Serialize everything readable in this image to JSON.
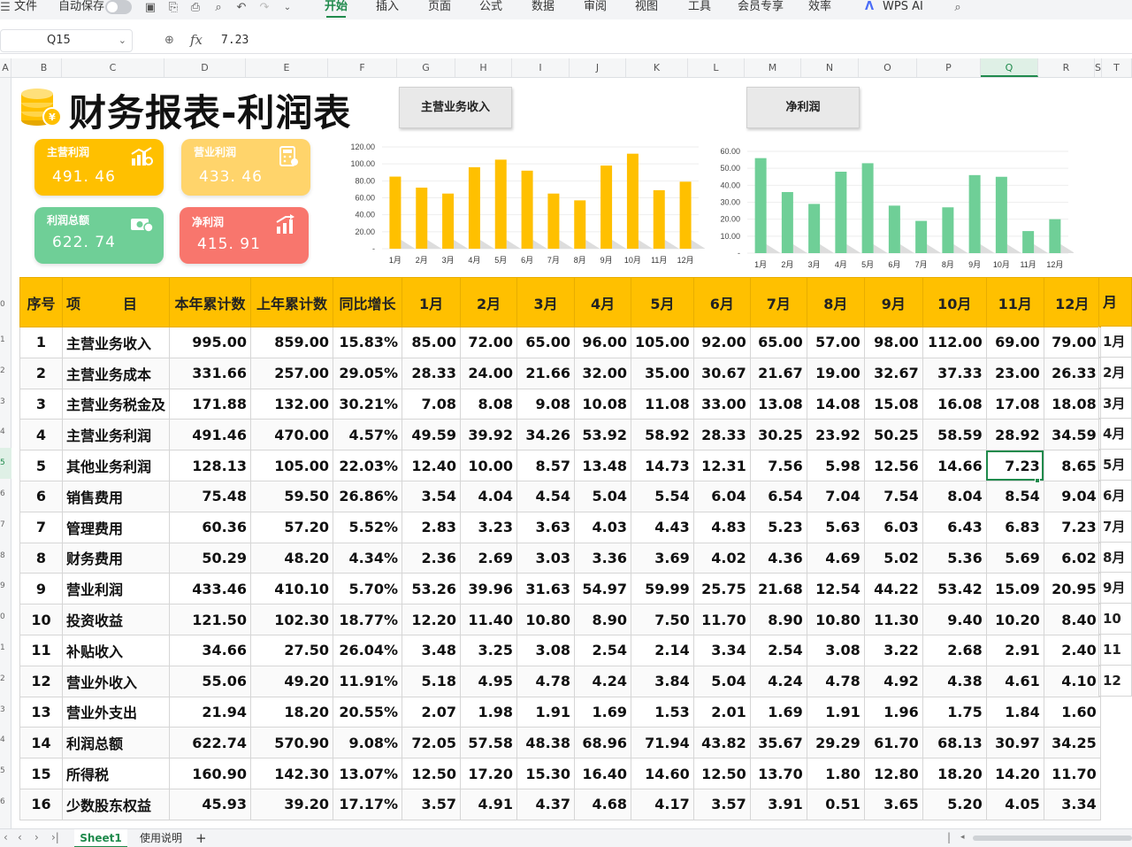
{
  "menu": {
    "file": "文件",
    "autosave": "自动保存",
    "tabs": [
      "开始",
      "插入",
      "页面",
      "公式",
      "数据",
      "审阅",
      "视图",
      "工具",
      "会员专享",
      "效率"
    ],
    "active_tab": "开始",
    "wps_ai": "WPS AI"
  },
  "formula": {
    "cell_ref": "Q15",
    "value": "7.23"
  },
  "columns": [
    "A",
    "B",
    "C",
    "D",
    "E",
    "F",
    "G",
    "H",
    "I",
    "J",
    "K",
    "L",
    "M",
    "N",
    "O",
    "P",
    "Q",
    "R",
    "S",
    "T"
  ],
  "selected_column": "Q",
  "row_numbers": [
    "0",
    "1",
    "2",
    "3",
    "4",
    "5",
    "6",
    "7",
    "8",
    "9",
    "0",
    "1",
    "2",
    "3",
    "4",
    "5",
    "6"
  ],
  "title": "财务报表-利润表",
  "buttons": {
    "revenue": "主营业务收入",
    "net_profit": "净利润"
  },
  "cards": [
    {
      "label": "主营利润",
      "value": "491. 46",
      "color": "#ffc000"
    },
    {
      "label": "营业利润",
      "value": "433. 46",
      "color": "#ffd46b"
    },
    {
      "label": "利润总额",
      "value": "622. 74",
      "color": "#6fcf97"
    },
    {
      "label": "净利润",
      "value": "415. 91",
      "color": "#f8766d"
    }
  ],
  "chart_data": [
    {
      "type": "bar",
      "categories": [
        "1月",
        "2月",
        "3月",
        "4月",
        "5月",
        "6月",
        "7月",
        "8月",
        "9月",
        "10月",
        "11月",
        "12月"
      ],
      "values": [
        85,
        72,
        65,
        96,
        105,
        92,
        65,
        57,
        98,
        112,
        69,
        79
      ],
      "ylim": [
        0,
        120
      ],
      "yticks": [
        "120.00",
        "100.00",
        "80.00",
        "60.00",
        "40.00",
        "20.00",
        "-"
      ],
      "color": "#ffc000"
    },
    {
      "type": "bar",
      "categories": [
        "1月",
        "2月",
        "3月",
        "4月",
        "5月",
        "6月",
        "7月",
        "8月",
        "9月",
        "10月",
        "11月",
        "12月"
      ],
      "values": [
        56,
        36,
        29,
        48,
        53,
        28,
        19,
        27,
        46,
        45,
        13,
        20
      ],
      "ylim": [
        0,
        60
      ],
      "yticks": [
        "60.00",
        "50.00",
        "40.00",
        "30.00",
        "20.00",
        "10.00",
        "-"
      ],
      "color": "#6fcf97"
    }
  ],
  "table": {
    "headers": [
      "序号",
      "项　　　目",
      "本年累计数",
      "上年累计数",
      "同比增长",
      "1月",
      "2月",
      "3月",
      "4月",
      "5月",
      "6月",
      "7月",
      "8月",
      "9月",
      "10月",
      "11月",
      "12月"
    ],
    "rows": [
      [
        "1",
        "主营业务收入",
        "995.00",
        "859.00",
        "15.83%",
        "85.00",
        "72.00",
        "65.00",
        "96.00",
        "105.00",
        "92.00",
        "65.00",
        "57.00",
        "98.00",
        "112.00",
        "69.00",
        "79.00"
      ],
      [
        "2",
        "主营业务成本",
        "331.66",
        "257.00",
        "29.05%",
        "28.33",
        "24.00",
        "21.66",
        "32.00",
        "35.00",
        "30.67",
        "21.67",
        "19.00",
        "32.67",
        "37.33",
        "23.00",
        "26.33"
      ],
      [
        "3",
        "主营业务税金及",
        "171.88",
        "132.00",
        "30.21%",
        "7.08",
        "8.08",
        "9.08",
        "10.08",
        "11.08",
        "33.00",
        "13.08",
        "14.08",
        "15.08",
        "16.08",
        "17.08",
        "18.08"
      ],
      [
        "4",
        "主营业务利润",
        "491.46",
        "470.00",
        "4.57%",
        "49.59",
        "39.92",
        "34.26",
        "53.92",
        "58.92",
        "28.33",
        "30.25",
        "23.92",
        "50.25",
        "58.59",
        "28.92",
        "34.59"
      ],
      [
        "5",
        "其他业务利润",
        "128.13",
        "105.00",
        "22.03%",
        "12.40",
        "10.00",
        "8.57",
        "13.48",
        "14.73",
        "12.31",
        "7.56",
        "5.98",
        "12.56",
        "14.66",
        "7.23",
        "8.65"
      ],
      [
        "6",
        "销售费用",
        "75.48",
        "59.50",
        "26.86%",
        "3.54",
        "4.04",
        "4.54",
        "5.04",
        "5.54",
        "6.04",
        "6.54",
        "7.04",
        "7.54",
        "8.04",
        "8.54",
        "9.04"
      ],
      [
        "7",
        "管理费用",
        "60.36",
        "57.20",
        "5.52%",
        "2.83",
        "3.23",
        "3.63",
        "4.03",
        "4.43",
        "4.83",
        "5.23",
        "5.63",
        "6.03",
        "6.43",
        "6.83",
        "7.23"
      ],
      [
        "8",
        "财务费用",
        "50.29",
        "48.20",
        "4.34%",
        "2.36",
        "2.69",
        "3.03",
        "3.36",
        "3.69",
        "4.02",
        "4.36",
        "4.69",
        "5.02",
        "5.36",
        "5.69",
        "6.02"
      ],
      [
        "9",
        "营业利润",
        "433.46",
        "410.10",
        "5.70%",
        "53.26",
        "39.96",
        "31.63",
        "54.97",
        "59.99",
        "25.75",
        "21.68",
        "12.54",
        "44.22",
        "53.42",
        "15.09",
        "20.95"
      ],
      [
        "10",
        "投资收益",
        "121.50",
        "102.30",
        "18.77%",
        "12.20",
        "11.40",
        "10.80",
        "8.90",
        "7.50",
        "11.70",
        "8.90",
        "10.80",
        "11.30",
        "9.40",
        "10.20",
        "8.40"
      ],
      [
        "11",
        "补贴收入",
        "34.66",
        "27.50",
        "26.04%",
        "3.48",
        "3.25",
        "3.08",
        "2.54",
        "2.14",
        "3.34",
        "2.54",
        "3.08",
        "3.22",
        "2.68",
        "2.91",
        "2.40"
      ],
      [
        "12",
        "营业外收入",
        "55.06",
        "49.20",
        "11.91%",
        "5.18",
        "4.95",
        "4.78",
        "4.24",
        "3.84",
        "5.04",
        "4.24",
        "4.78",
        "4.92",
        "4.38",
        "4.61",
        "4.10"
      ],
      [
        "13",
        "营业外支出",
        "21.94",
        "18.20",
        "20.55%",
        "2.07",
        "1.98",
        "1.91",
        "1.69",
        "1.53",
        "2.01",
        "1.69",
        "1.91",
        "1.96",
        "1.75",
        "1.84",
        "1.60"
      ],
      [
        "14",
        "利润总额",
        "622.74",
        "570.90",
        "9.08%",
        "72.05",
        "57.58",
        "48.38",
        "68.96",
        "71.94",
        "43.82",
        "35.67",
        "29.29",
        "61.70",
        "68.13",
        "30.97",
        "34.25"
      ],
      [
        "15",
        "所得税",
        "160.90",
        "142.30",
        "13.07%",
        "12.50",
        "17.20",
        "15.30",
        "16.40",
        "14.60",
        "12.50",
        "13.70",
        "1.80",
        "12.80",
        "18.20",
        "14.20",
        "11.70"
      ],
      [
        "16",
        "少数股东权益",
        "45.93",
        "39.20",
        "17.17%",
        "3.57",
        "4.91",
        "4.37",
        "4.68",
        "4.17",
        "3.57",
        "3.91",
        "0.51",
        "3.65",
        "5.20",
        "4.05",
        "3.34"
      ]
    ]
  },
  "right_partial": {
    "header": "月",
    "rows": [
      "1月",
      "2月",
      "3月",
      "4月",
      "5月",
      "6月",
      "7月",
      "8月",
      "9月",
      "10",
      "11",
      "12"
    ]
  },
  "sheets": {
    "active": "Sheet1",
    "other": "使用说明",
    "add": "+"
  },
  "nav_icons": [
    "first",
    "prev",
    "next",
    "last"
  ]
}
